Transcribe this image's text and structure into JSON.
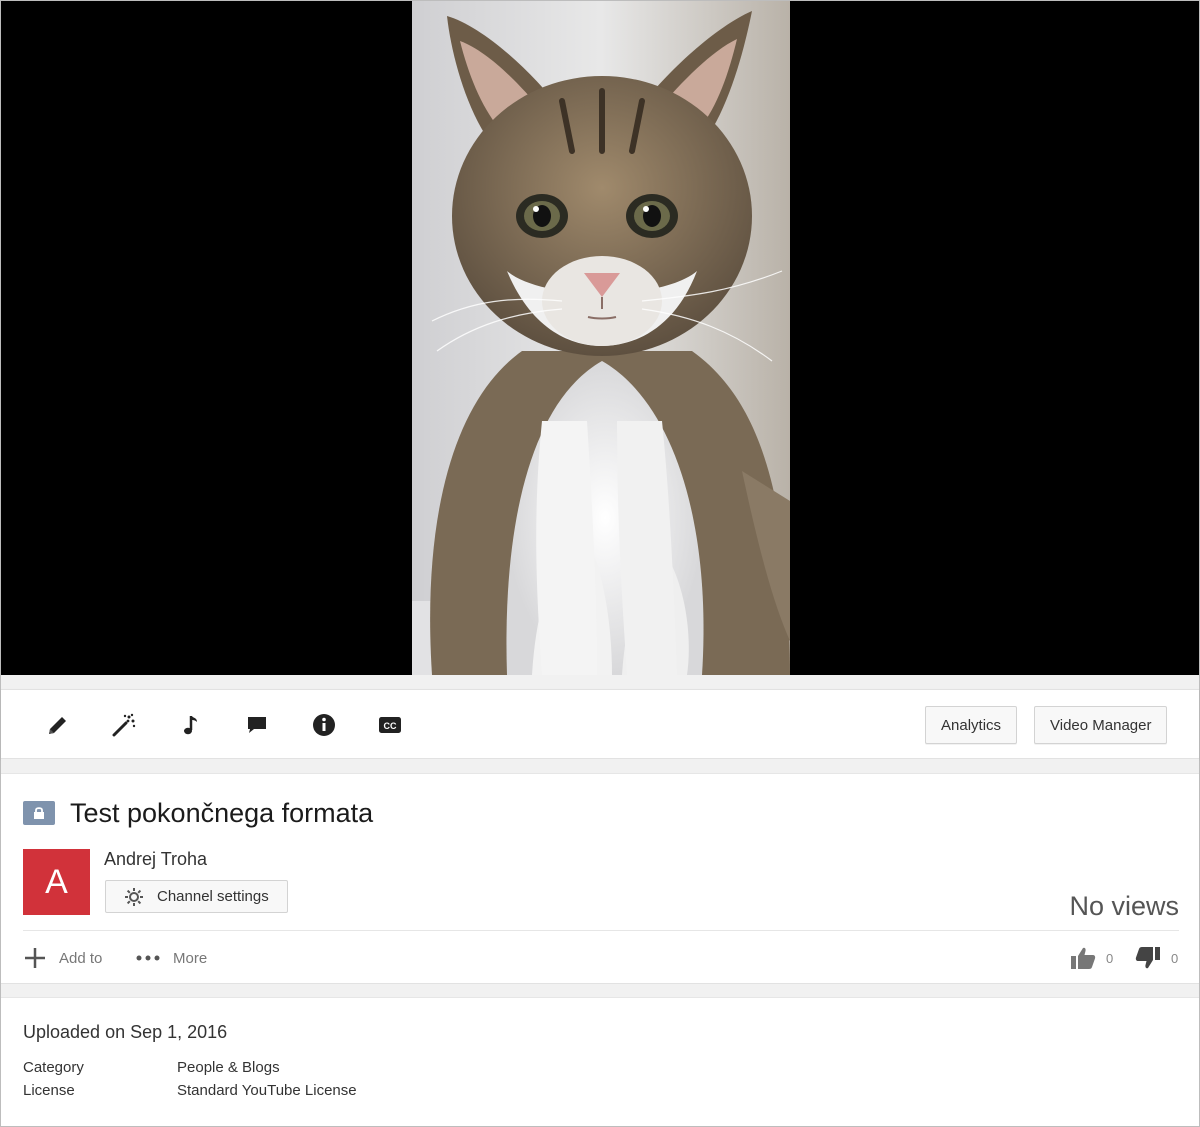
{
  "toolbar": {
    "icons": [
      "pencil-icon",
      "magic-wand-icon",
      "music-note-icon",
      "comment-icon",
      "info-icon",
      "closed-captions-icon"
    ],
    "analytics_label": "Analytics",
    "video_manager_label": "Video Manager"
  },
  "video": {
    "title": "Test pokončnega formata",
    "privacy_icon": "lock-icon",
    "views": "No views"
  },
  "channel": {
    "avatar_letter": "A",
    "avatar_color": "#d1323a",
    "name": "Andrej Troha",
    "settings_label": "Channel settings"
  },
  "actions": {
    "add_to_label": "Add to",
    "more_label": "More",
    "likes": "0",
    "dislikes": "0"
  },
  "details": {
    "uploaded": "Uploaded on Sep 1, 2016",
    "category_label": "Category",
    "category_value": "People & Blogs",
    "license_label": "License",
    "license_value": "Standard YouTube License"
  }
}
